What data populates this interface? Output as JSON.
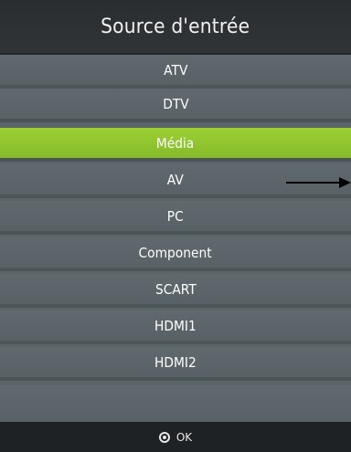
{
  "window": {
    "title": "Source d'entrée"
  },
  "source_list": {
    "items": [
      {
        "label": "ATV",
        "selected": false
      },
      {
        "label": "DTV",
        "selected": false
      },
      {
        "label": "Média",
        "selected": true
      },
      {
        "label": "AV",
        "selected": false
      },
      {
        "label": "PC",
        "selected": false
      },
      {
        "label": "Component",
        "selected": false
      },
      {
        "label": "SCART",
        "selected": false
      },
      {
        "label": "HDMI1",
        "selected": false
      },
      {
        "label": "HDMI2",
        "selected": false
      }
    ]
  },
  "footer": {
    "ok_label": "OK",
    "icon": "ok-circle-icon"
  },
  "colors": {
    "selected": "#8fc42d",
    "list_background": "#5b6468",
    "header_background": "#2d3133",
    "footer_background": "#1e2224"
  }
}
